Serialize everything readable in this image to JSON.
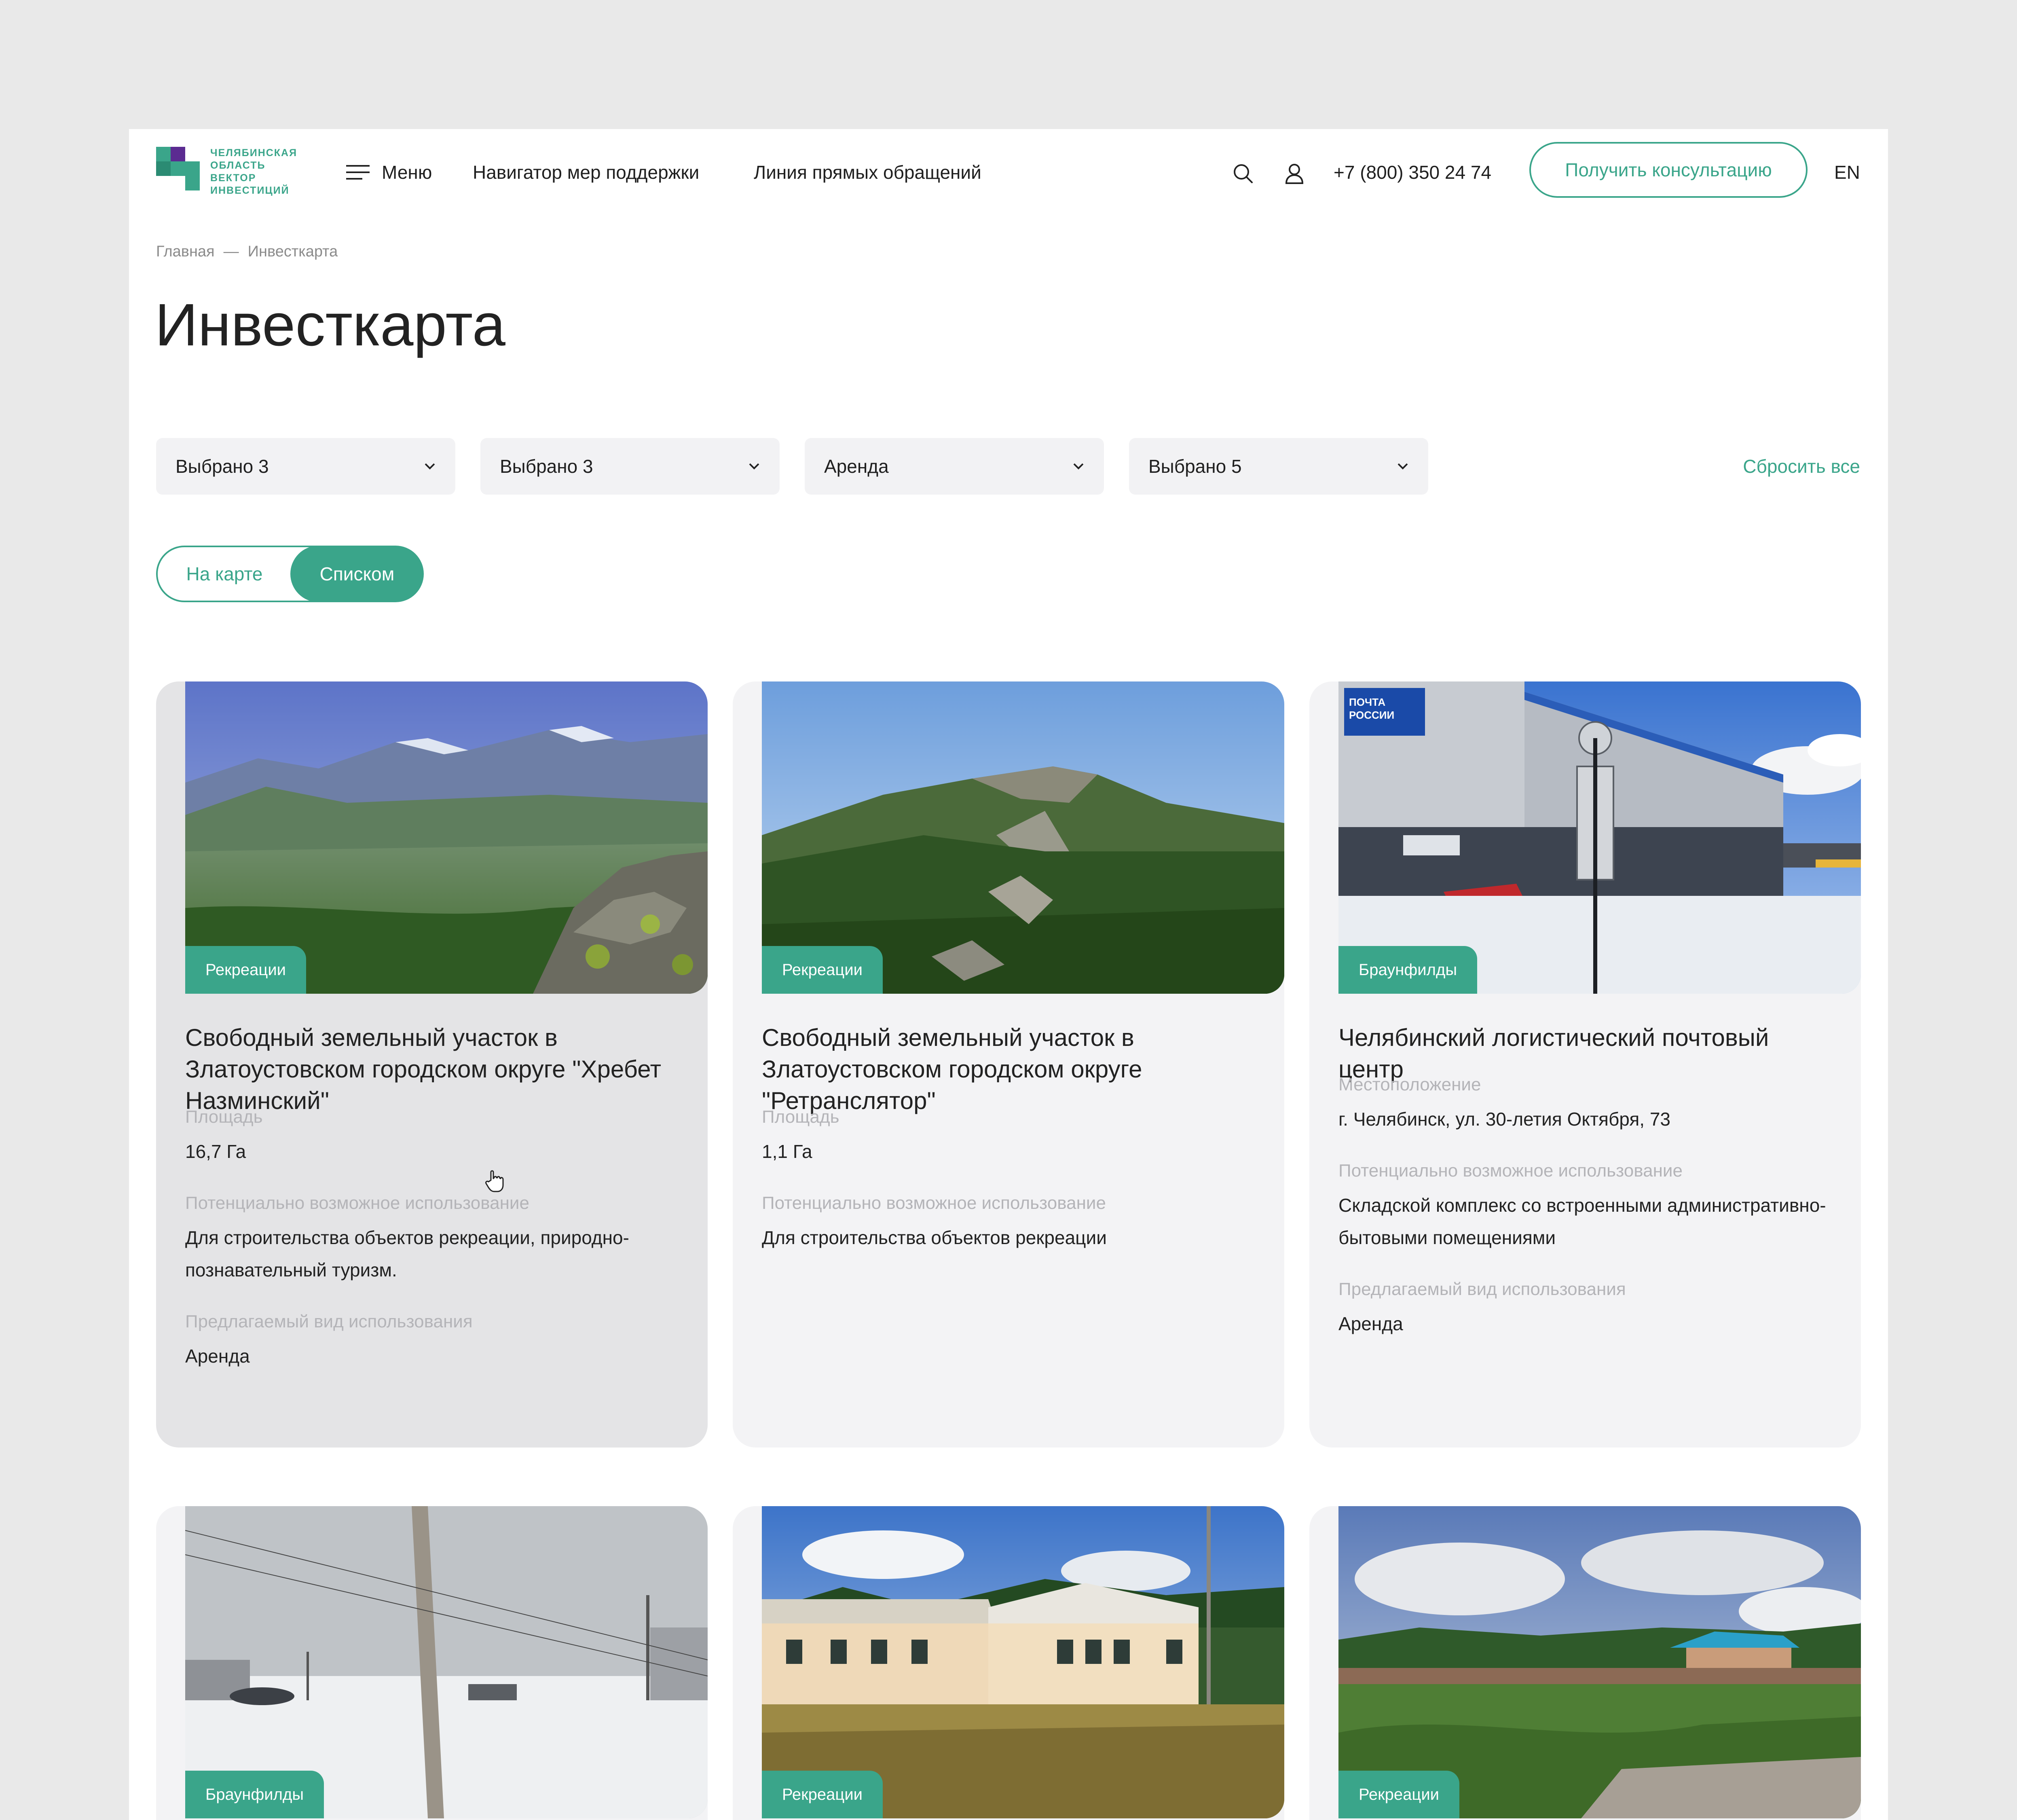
{
  "header": {
    "logo_text": [
      "ЧЕЛЯБИНСКАЯ",
      "ОБЛАСТЬ",
      "ВЕКТОР",
      "ИНВЕСТИЦИЙ"
    ],
    "menu_label": "Меню",
    "nav": [
      "Навигатор мер поддержки",
      "Линия прямых обращений"
    ],
    "icons": [
      "search-icon",
      "user-icon",
      "menu-icon"
    ],
    "phone": "+7 (800) 350 24 74",
    "consult_button": "Получить консультацию",
    "lang": "EN"
  },
  "breadcrumb": {
    "home": "Главная",
    "separator": "—",
    "current": "Инвесткарта"
  },
  "title": "Инвесткарта",
  "filters": [
    "Выбрано 3",
    "Выбрано 3",
    "Аренда",
    "Выбрано 5"
  ],
  "reset_label": "Сбросить все",
  "view_toggle": {
    "map": "На карте",
    "list": "Списком",
    "active": "list"
  },
  "colors": {
    "accent": "#3aa58a",
    "card_bg": "#f3f3f5",
    "card_hover_bg": "#e4e4e6",
    "label": "#b4b4b8"
  },
  "cards": [
    {
      "tag": "Рекреации",
      "title": "Свободный земельный участок в Златоустовском городском округе \"Хребет Назминский\"",
      "fields": [
        {
          "label": "Площадь",
          "value": "16,7 Га"
        },
        {
          "label": "Потенциально возможное использование",
          "value": "Для строительства объектов рекреации, природно-познавательный туризм."
        },
        {
          "label": "Предлагаемый вид использования",
          "value": "Аренда"
        }
      ]
    },
    {
      "tag": "Рекреации",
      "title": "Свободный земельный участок в Златоустовском городском округе \"Ретранслятор\"",
      "fields": [
        {
          "label": "Площадь",
          "value": "1,1 Га"
        },
        {
          "label": "Потенциально возможное использование",
          "value": "Для строительства объектов рекреации"
        }
      ]
    },
    {
      "tag": "Браунфилды",
      "title": "Челябинский логистический почтовый центр",
      "fields": [
        {
          "label": "Местоположение",
          "value": "г. Челябинск, ул. 30-летия Октября, 73"
        },
        {
          "label": "Потенциально возможное использование",
          "value": "Складской комплекс со встроенными административно-бытовыми помещениями"
        },
        {
          "label": "Предлагаемый вид использования",
          "value": "Аренда"
        }
      ]
    },
    {
      "tag": "Браунфилды"
    },
    {
      "tag": "Рекреации"
    },
    {
      "tag": "Рекреации"
    }
  ],
  "image_overlay_text": {
    "post_sign": "ПОЧТА РОССИИ"
  }
}
